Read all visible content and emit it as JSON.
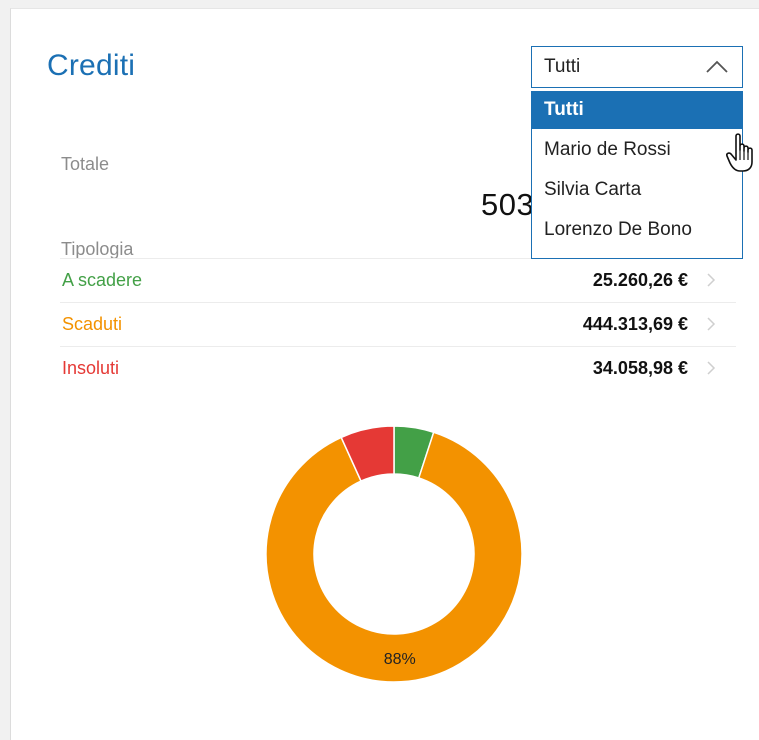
{
  "card": {
    "title": "Crediti",
    "select": {
      "value": "Tutti",
      "options": [
        "Tutti",
        "Mario de Rossi",
        "Silvia Carta",
        "Lorenzo De Bono"
      ],
      "selected_index": 0
    },
    "totale_label": "Totale",
    "totale_value_visible": "503",
    "tipologia_label": "Tipologia",
    "rows": [
      {
        "label": "A scadere",
        "amount": "25.260,26 €",
        "color": "#43a047"
      },
      {
        "label": "Scaduti",
        "amount": "444.313,69 €",
        "color": "#f39200"
      },
      {
        "label": "Insoluti",
        "amount": "34.058,98 €",
        "color": "#e53935"
      }
    ]
  },
  "icons": {
    "select_arrow": "chevron-up-icon",
    "row_arrow": "chevron-right-icon",
    "cursor": "hand-pointer-icon"
  },
  "chart_data": {
    "type": "pie",
    "donut": true,
    "categories": [
      "A scadere",
      "Scaduti",
      "Insoluti"
    ],
    "values": [
      25260.26,
      444313.69,
      34058.98
    ],
    "colors": [
      "#43a047",
      "#f39200",
      "#e53935"
    ],
    "data_labels": [
      "",
      "88%",
      ""
    ]
  }
}
